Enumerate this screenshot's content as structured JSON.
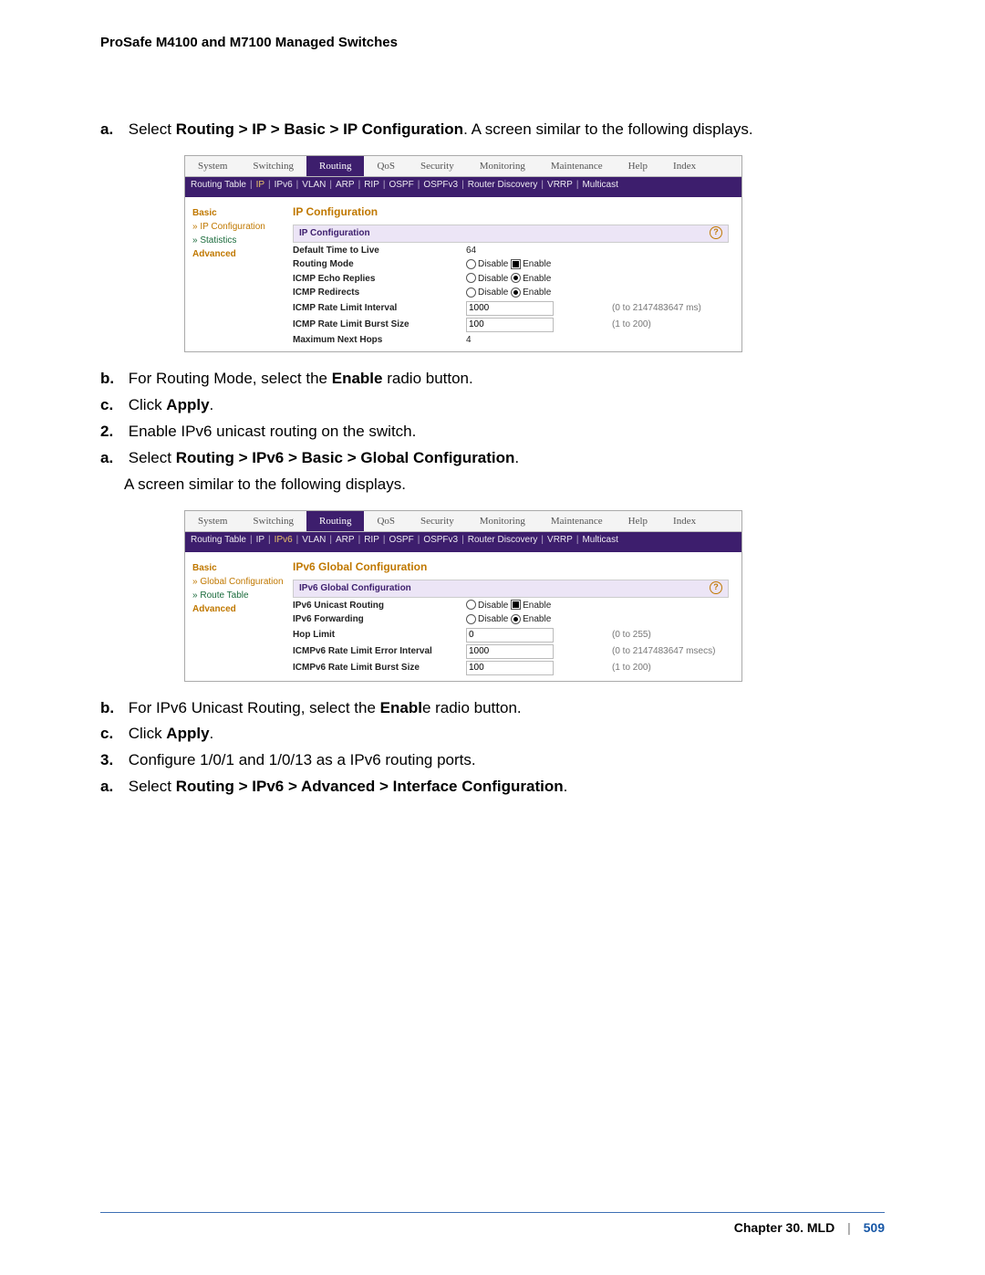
{
  "doc_title": "ProSafe M4100 and M7100 Managed Switches",
  "step1a": {
    "marker": "a.",
    "pre": "Select ",
    "path": "Routing > IP > Basic > IP Configuration",
    "post": ". A screen similar to the following displays."
  },
  "step1b": {
    "marker": "b.",
    "pre": "For Routing Mode, select the ",
    "bold": "Enable",
    "post": " radio button."
  },
  "step1c": {
    "marker": "c.",
    "pre": "Click ",
    "bold": "Apply",
    "post": "."
  },
  "step2": {
    "marker": "2.",
    "text": "Enable IPv6 unicast routing on the switch."
  },
  "step2a": {
    "marker": "a.",
    "pre": "Select ",
    "path": "Routing > IPv6 > Basic > Global Configuration",
    "post": "."
  },
  "step2a_line2": "A screen similar to the following displays.",
  "step2b": {
    "marker": "b.",
    "pre": "For IPv6 Unicast Routing, select the ",
    "bold": "Enabl",
    "post": "e radio button."
  },
  "step2c": {
    "marker": "c.",
    "pre": "Click ",
    "bold": "Apply",
    "post": "."
  },
  "step3": {
    "marker": "3.",
    "text": "Configure 1/0/1 and 1/0/13 as a IPv6 routing ports."
  },
  "step3a": {
    "marker": "a.",
    "pre": "Select ",
    "path": "Routing > IPv6 > Advanced > Interface Configuration",
    "post": "."
  },
  "tabs_main": [
    "System",
    "Switching",
    "Routing",
    "QoS",
    "Security",
    "Monitoring",
    "Maintenance",
    "Help",
    "Index"
  ],
  "shot1": {
    "subtabs": [
      "Routing Table",
      "IP",
      "IPv6",
      "VLAN",
      "ARP",
      "RIP",
      "OSPF",
      "OSPFv3",
      "Router Discovery",
      "VRRP",
      "Multicast"
    ],
    "hi_index": 1,
    "sidebar": {
      "cat": "Basic",
      "cur": "IP Configuration",
      "lnk": "Statistics",
      "adv": "Advanced"
    },
    "panel_title": "IP Configuration",
    "panel_bar": "IP Configuration",
    "rows": [
      {
        "label": "Default Time to Live",
        "val": "64"
      },
      {
        "label": "Routing Mode",
        "radio": true,
        "sel": "enable_box"
      },
      {
        "label": "ICMP Echo Replies",
        "radio": true,
        "sel": "enable_dot"
      },
      {
        "label": "ICMP Redirects",
        "radio": true,
        "sel": "enable_dot"
      },
      {
        "label": "ICMP Rate Limit Interval",
        "input": "1000",
        "hint": "(0 to 2147483647 ms)"
      },
      {
        "label": "ICMP Rate Limit Burst Size",
        "input": "100",
        "hint": "(1 to 200)"
      },
      {
        "label": "Maximum Next Hops",
        "val": "4"
      }
    ]
  },
  "shot2": {
    "subtabs": [
      "Routing Table",
      "IP",
      "IPv6",
      "VLAN",
      "ARP",
      "RIP",
      "OSPF",
      "OSPFv3",
      "Router Discovery",
      "VRRP",
      "Multicast"
    ],
    "hi_index": 2,
    "sidebar": {
      "cat": "Basic",
      "cur": "Global Configuration",
      "lnk": "Route Table",
      "adv": "Advanced"
    },
    "panel_title": "IPv6 Global Configuration",
    "panel_bar": "IPv6 Global Configuration",
    "rows": [
      {
        "label": "IPv6 Unicast Routing",
        "radio": true,
        "sel": "enable_box"
      },
      {
        "label": "IPv6 Forwarding",
        "radio": true,
        "sel": "enable_dot"
      },
      {
        "label": "Hop Limit",
        "input": "0",
        "hint": "(0 to 255)"
      },
      {
        "label": "ICMPv6 Rate Limit Error Interval",
        "input": "1000",
        "hint": "(0 to 2147483647 msecs)"
      },
      {
        "label": "ICMPv6 Rate Limit Burst Size",
        "input": "100",
        "hint": "(1 to 200)"
      }
    ]
  },
  "radio_labels": {
    "disable": "Disable",
    "enable": "Enable"
  },
  "footer": {
    "chapter": "Chapter 30.  MLD",
    "page": "509"
  }
}
